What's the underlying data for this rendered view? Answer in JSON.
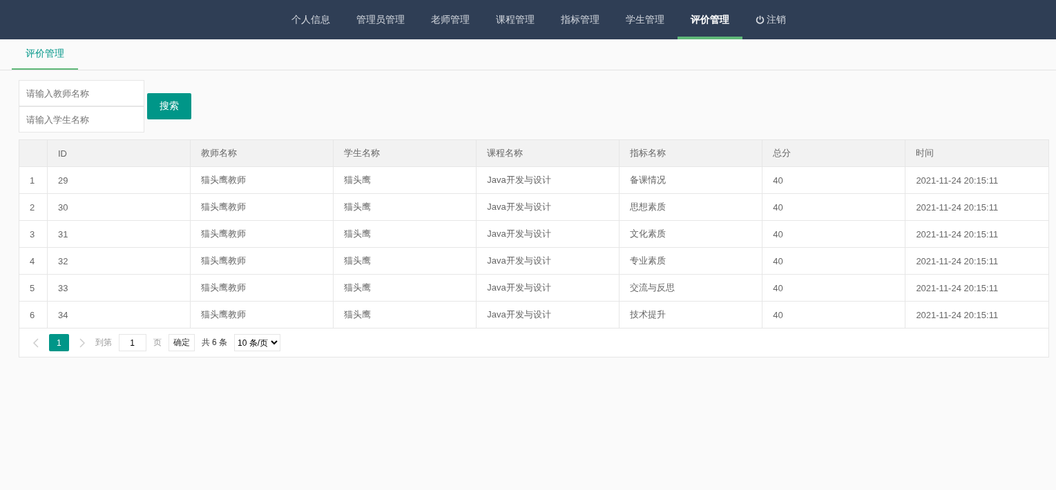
{
  "nav": [
    {
      "label": "个人信息",
      "selected": false
    },
    {
      "label": "管理员管理",
      "selected": false
    },
    {
      "label": "老师管理",
      "selected": false
    },
    {
      "label": "课程管理",
      "selected": false
    },
    {
      "label": "指标管理",
      "selected": false
    },
    {
      "label": "学生管理",
      "selected": false
    },
    {
      "label": "评价管理",
      "selected": true
    },
    {
      "label": "注销",
      "selected": false,
      "kind": "logout"
    }
  ],
  "tabs": [
    {
      "label": "评价管理",
      "selected": true
    }
  ],
  "search": {
    "fields": [
      {
        "placeholder": "请输入教师名称"
      },
      {
        "placeholder": "请输入学生名称"
      }
    ],
    "button": "搜索"
  },
  "table": {
    "columns": [
      "",
      "ID",
      "教师名称",
      "学生名称",
      "课程名称",
      "指标名称",
      "总分",
      "时间"
    ],
    "rows": [
      [
        "1",
        "29",
        "猫头鹰教师",
        "猫头鹰",
        "Java开发与设计",
        "备课情况",
        "40",
        "2021-11-24 20:15:11"
      ],
      [
        "2",
        "30",
        "猫头鹰教师",
        "猫头鹰",
        "Java开发与设计",
        "思想素质",
        "40",
        "2021-11-24 20:15:11"
      ],
      [
        "3",
        "31",
        "猫头鹰教师",
        "猫头鹰",
        "Java开发与设计",
        "文化素质",
        "40",
        "2021-11-24 20:15:11"
      ],
      [
        "4",
        "32",
        "猫头鹰教师",
        "猫头鹰",
        "Java开发与设计",
        "专业素质",
        "40",
        "2021-11-24 20:15:11"
      ],
      [
        "5",
        "33",
        "猫头鹰教师",
        "猫头鹰",
        "Java开发与设计",
        "交流与反思",
        "40",
        "2021-11-24 20:15:11"
      ],
      [
        "6",
        "34",
        "猫头鹰教师",
        "猫头鹰",
        "Java开发与设计",
        "技术提升",
        "40",
        "2021-11-24 20:15:11"
      ]
    ]
  },
  "pagination": {
    "pages": [
      {
        "label": "1",
        "selected": true
      }
    ],
    "goto_label": "到第",
    "page_input": "1",
    "page_suffix": "页",
    "confirm": "确定",
    "total": "共 6 条",
    "page_size": "10 条/页"
  }
}
